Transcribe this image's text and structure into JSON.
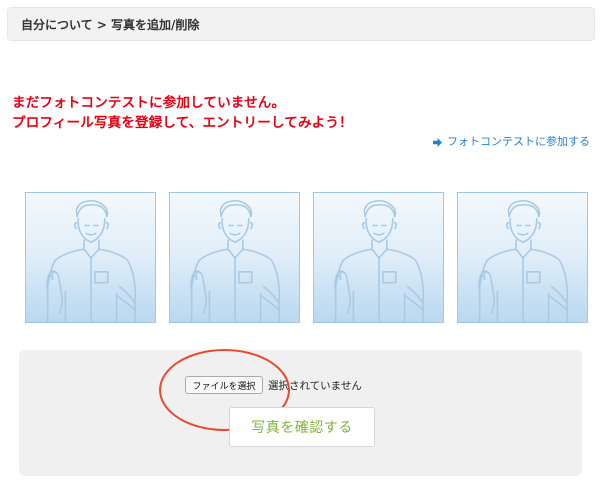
{
  "breadcrumb": "自分について > 写真を追加/削除",
  "warning": {
    "line1": "まだフォトコンテストに参加していません。",
    "line2": "プロフィール写真を登録して、エントリーしてみよう！"
  },
  "contest_link": {
    "label": "フォトコンテストに参加する",
    "icon": "arrow-right-icon"
  },
  "photo_slots": [
    {
      "icon": "person-placeholder-icon"
    },
    {
      "icon": "person-placeholder-icon"
    },
    {
      "icon": "person-placeholder-icon"
    },
    {
      "icon": "person-placeholder-icon"
    }
  ],
  "upload": {
    "file_button_label": "ファイルを選択",
    "file_status": "選択されていません",
    "confirm_label": "写真を確認する"
  },
  "colors": {
    "warning": "#e60012",
    "link": "#2a7fc9",
    "confirm_text": "#7fb43c",
    "highlight_annotation": "#e84a2f",
    "placeholder_line": "#a9c9e4"
  }
}
